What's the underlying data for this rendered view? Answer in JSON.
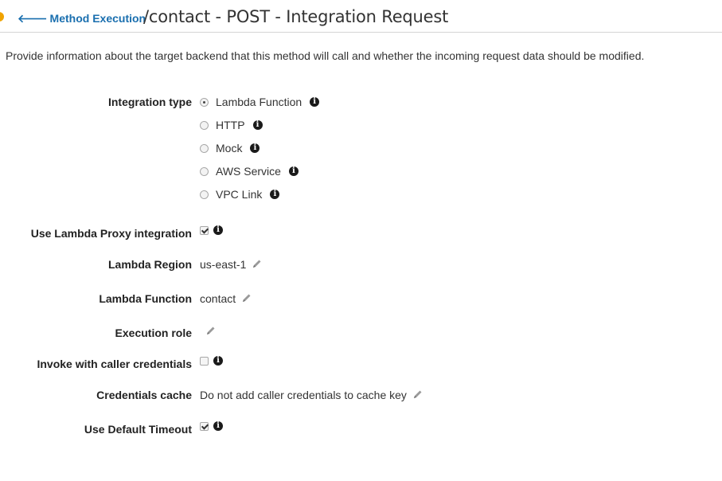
{
  "header": {
    "back_link": "Method Execution",
    "title": "/contact - POST - Integration Request"
  },
  "description": "Provide information about the target backend that this method will call and whether the incoming request data should be modified.",
  "integration_type": {
    "label": "Integration type",
    "selected": "Lambda Function",
    "options": [
      {
        "label": "Lambda Function"
      },
      {
        "label": "HTTP"
      },
      {
        "label": "Mock"
      },
      {
        "label": "AWS Service"
      },
      {
        "label": "VPC Link"
      }
    ]
  },
  "lambda_proxy": {
    "label": "Use Lambda Proxy integration",
    "checked": true
  },
  "lambda_region": {
    "label": "Lambda Region",
    "value": "us-east-1"
  },
  "lambda_function": {
    "label": "Lambda Function",
    "value": "contact"
  },
  "execution_role": {
    "label": "Execution role",
    "value": ""
  },
  "caller_credentials": {
    "label": "Invoke with caller credentials",
    "checked": false
  },
  "credentials_cache": {
    "label": "Credentials cache",
    "value": "Do not add caller credentials to cache key"
  },
  "default_timeout": {
    "label": "Use Default Timeout",
    "checked": true
  },
  "colors": {
    "link": "#1a6faf",
    "accent": "#f0a300"
  },
  "icons": [
    "arrow-left-icon",
    "info-icon",
    "pencil-icon"
  ]
}
